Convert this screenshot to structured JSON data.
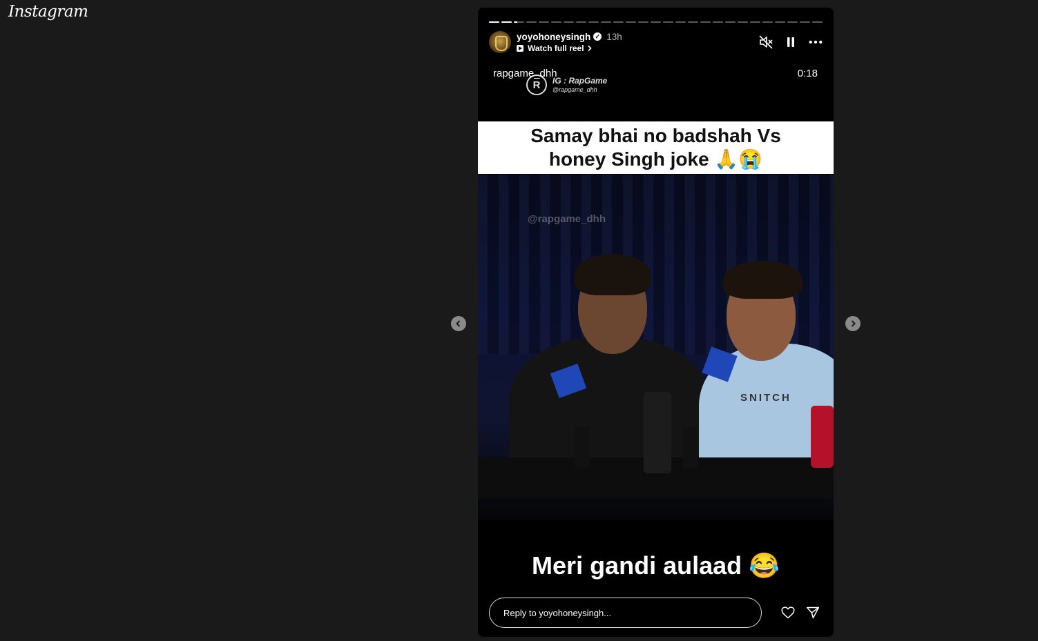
{
  "app": {
    "logo_text": "Instagram"
  },
  "story": {
    "segments_total": 27,
    "active_segment_index": 2,
    "active_segment_progress": 0.3,
    "username": "yoyohoneysingh",
    "verified": true,
    "time_ago": "13h",
    "watch_full_reel": "Watch full reel",
    "source_label": "rapgame_dhh",
    "timer": "0:18",
    "watermark_top_title": "IG : RapGame",
    "watermark_top_handle": "@rapgame_dhh",
    "caption_top_line1": "Samay bhai no badshah Vs",
    "caption_top_line2": "honey Singh joke 🙏😭",
    "scene_watermark": "@rapgame_dhh",
    "shirt_text": "SNITCH",
    "caption_bottom": "Meri gandi aulaad 😂",
    "reply_placeholder": "Reply to yoyohoneysingh..."
  },
  "icons": {
    "mute": "speaker-muted-icon",
    "pause": "pause-icon",
    "more": "more-horizontal-icon",
    "like": "heart-icon",
    "share": "send-icon",
    "prev": "chevron-left-icon",
    "next": "chevron-right-icon"
  }
}
